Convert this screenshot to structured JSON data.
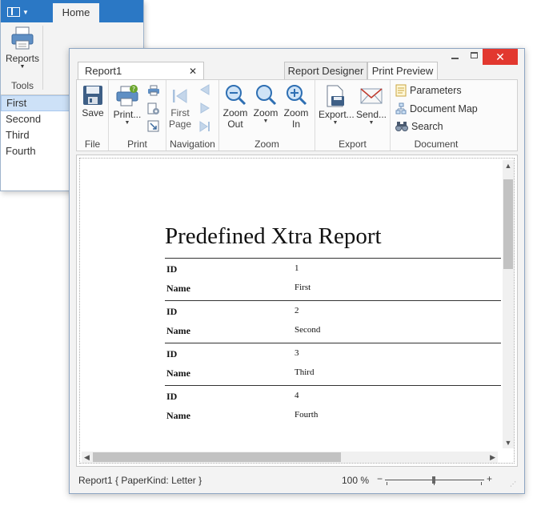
{
  "background_app": {
    "tab_home": "Home",
    "reports_label": "Reports",
    "tools_group": "Tools",
    "list_items": [
      "First",
      "Second",
      "Third",
      "Fourth"
    ]
  },
  "window": {
    "doc_tab": "Report1",
    "tab_designer": "Report Designer",
    "tab_preview": "Print Preview",
    "close_glyph": "✕"
  },
  "ribbon": {
    "file": {
      "label": "File",
      "save": "Save"
    },
    "print": {
      "label": "Print",
      "print": "Print..."
    },
    "navigation": {
      "label": "Navigation",
      "first_page_line1": "First",
      "first_page_line2": "Page"
    },
    "zoom": {
      "label": "Zoom",
      "zoom_out_1": "Zoom",
      "zoom_out_2": "Out",
      "zoom": "Zoom",
      "zoom_in_1": "Zoom",
      "zoom_in_2": "In"
    },
    "export": {
      "label": "Export",
      "export": "Export...",
      "send": "Send..."
    },
    "document": {
      "label": "Document",
      "parameters": "Parameters",
      "document_map": "Document Map",
      "search": "Search"
    }
  },
  "report": {
    "title": "Predefined Xtra Report",
    "id_label": "ID",
    "name_label": "Name",
    "records": [
      {
        "id": "1",
        "name": "First"
      },
      {
        "id": "2",
        "name": "Second"
      },
      {
        "id": "3",
        "name": "Third"
      },
      {
        "id": "4",
        "name": "Fourth"
      }
    ]
  },
  "status": {
    "info": "Report1 { PaperKind: Letter }",
    "zoom": "100 %"
  },
  "colors": {
    "accent": "#2b78c5",
    "close": "#e2382f",
    "selection": "#cde1f7"
  }
}
